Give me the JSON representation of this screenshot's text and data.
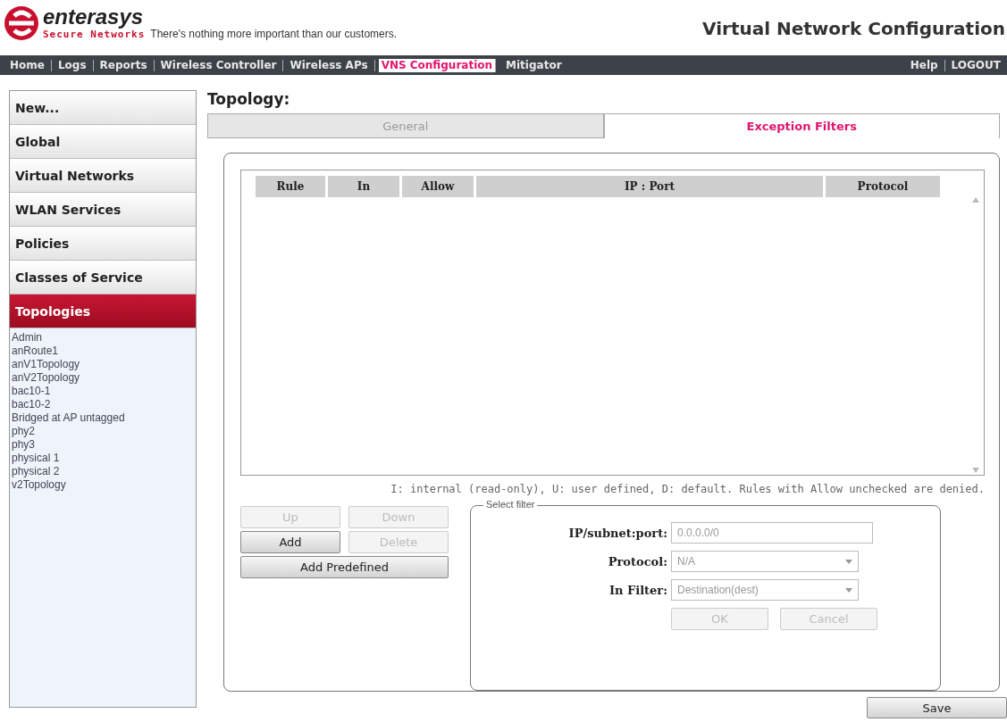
{
  "header": {
    "brand": "enterasys",
    "brand_sub": "Secure Networks",
    "tagline": "There's nothing more important than our customers.",
    "title": "Virtual Network Configuration"
  },
  "nav": [
    {
      "label": "Home",
      "selected": false
    },
    {
      "label": "Logs",
      "selected": false
    },
    {
      "label": "Reports",
      "selected": false
    },
    {
      "label": "Wireless Controller",
      "selected": false
    },
    {
      "label": "Wireless APs",
      "selected": false
    },
    {
      "label": "VNS Configuration",
      "selected": true
    },
    {
      "label": "Mitigator",
      "selected": false
    }
  ],
  "nav_right": [
    "Help",
    "LOGOUT"
  ],
  "sidebar": {
    "items": [
      {
        "label": "New...",
        "selected": false
      },
      {
        "label": "Global",
        "selected": false
      },
      {
        "label": "Virtual Networks",
        "selected": false
      },
      {
        "label": "WLAN Services",
        "selected": false
      },
      {
        "label": "Policies",
        "selected": false
      },
      {
        "label": "Classes of Service",
        "selected": false
      },
      {
        "label": "Topologies",
        "selected": true
      }
    ],
    "topologies": [
      "Admin",
      "anRoute1",
      "anV1Topology",
      "anV2Topology",
      "bac10-1",
      "bac10-2",
      "Bridged at AP untagged",
      "phy2",
      "phy3",
      "physical 1",
      "physical 2",
      "v2Topology"
    ]
  },
  "page_title": "Topology:",
  "tabs": [
    {
      "label": "General",
      "selected": false
    },
    {
      "label": "Exception Filters",
      "selected": true
    }
  ],
  "table": {
    "columns": [
      "Rule",
      "In",
      "Allow",
      "IP : Port",
      "Protocol"
    ]
  },
  "legend": "I: internal (read-only), U: user defined, D: default. Rules with Allow unchecked are denied.",
  "buttons": [
    {
      "label": "Up",
      "disabled": true
    },
    {
      "label": "Down",
      "disabled": true
    },
    {
      "label": "Add",
      "disabled": false
    },
    {
      "label": "Delete",
      "disabled": true
    },
    {
      "label": "Add Predefined",
      "disabled": false
    }
  ],
  "filter": {
    "title": "Select filter",
    "fields": [
      {
        "kind": "text",
        "label": "IP/subnet:port:",
        "value": "0.0.0.0/0"
      },
      {
        "kind": "select",
        "label": "Protocol:",
        "value": "N/A"
      },
      {
        "kind": "select",
        "label": "In Filter:",
        "value": "Destination(dest)"
      }
    ],
    "buttons": [
      {
        "label": "OK",
        "disabled": true
      },
      {
        "label": "Cancel",
        "disabled": true
      }
    ]
  },
  "save": {
    "label": "Save",
    "disabled": false
  }
}
